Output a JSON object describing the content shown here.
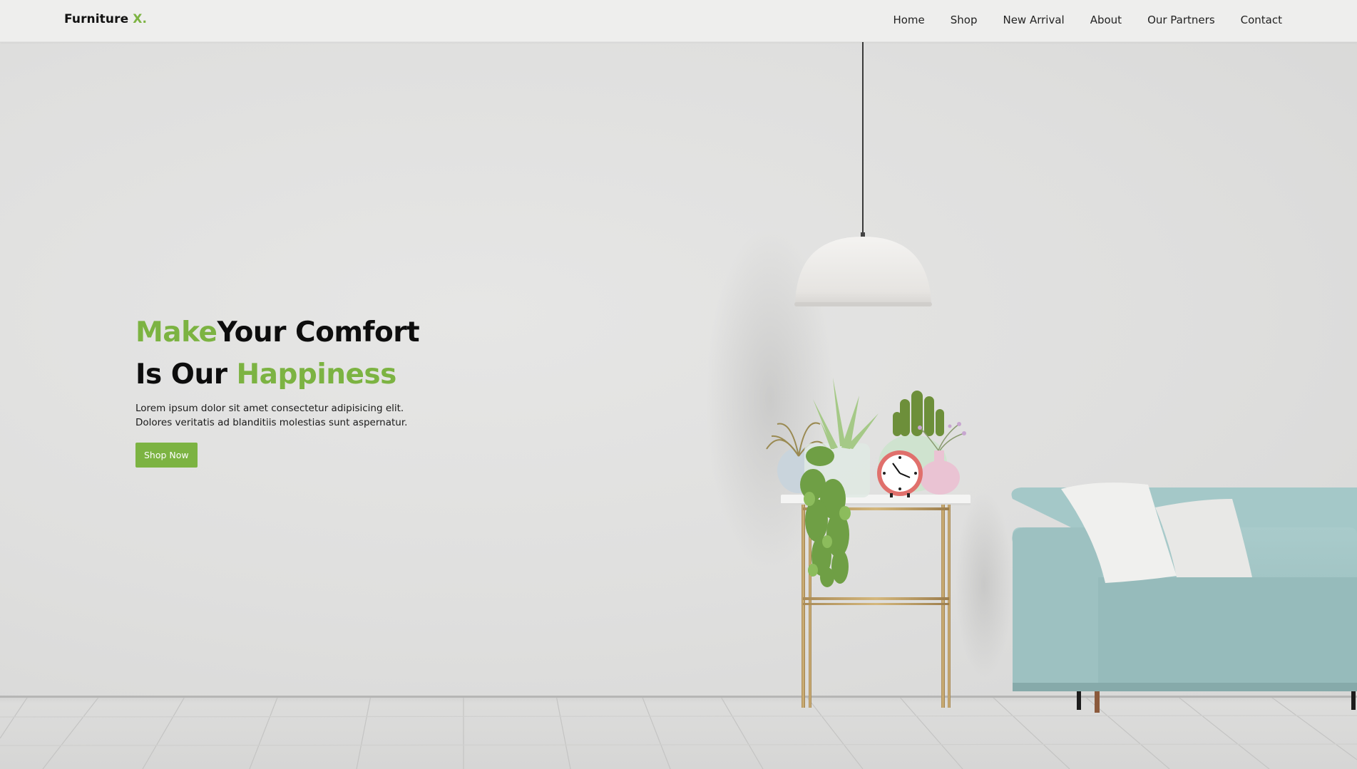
{
  "navbar": {
    "brand": {
      "name": "Furniture",
      "accent": "X."
    },
    "links": [
      {
        "label": "Home"
      },
      {
        "label": "Shop"
      },
      {
        "label": "New Arrival"
      },
      {
        "label": "About"
      },
      {
        "label": "Our Partners"
      },
      {
        "label": "Contact"
      }
    ]
  },
  "hero": {
    "title_line1_accent": "Make",
    "title_line1_rest": "Your Comfort",
    "title_line2_start": "Is Our ",
    "title_line2_accent": "Happiness",
    "description_line1": "Lorem ipsum dolor sit amet consectetur adipisicing elit.",
    "description_line2": "Dolores veritatis ad blanditiis molestias sunt aspernatur.",
    "cta_label": "Shop Now"
  },
  "colors": {
    "accent": "#7cb342",
    "navbar_bg": "#eeeeed",
    "wall": "#e2e2e1",
    "text_dark": "#0d0d0d"
  },
  "scene": {
    "items": [
      "pendant-lamp",
      "plant-table",
      "potted-plants",
      "table-clock",
      "sofa",
      "cushions",
      "wooden-floor"
    ]
  }
}
